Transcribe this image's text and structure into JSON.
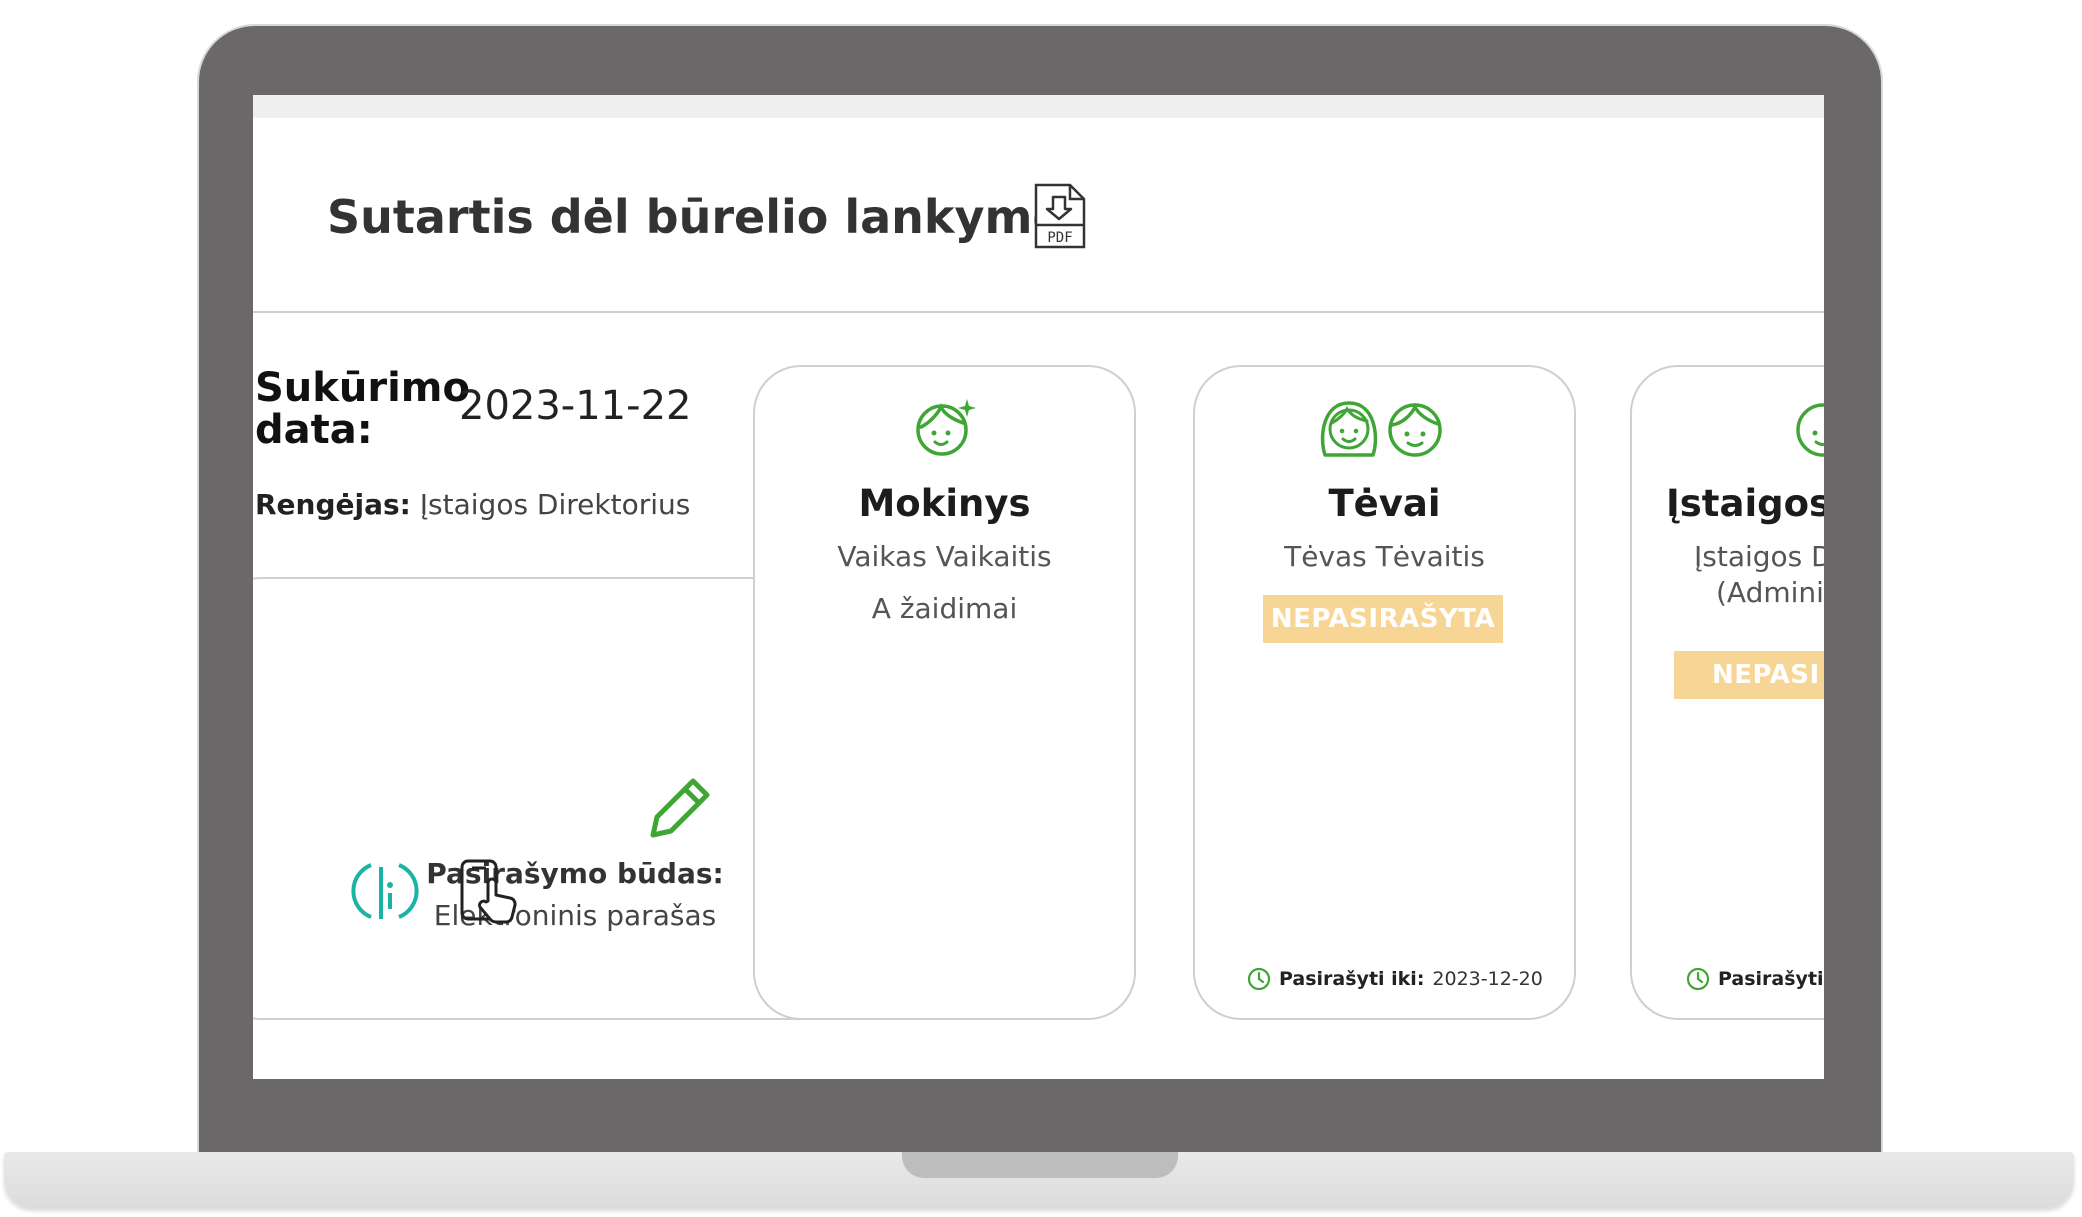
{
  "page": {
    "title": "Sutartis dėl būrelio lankymo",
    "pdf_label": "PDF"
  },
  "info": {
    "created_label": "Sukūrimo data:",
    "created_value": "2023-11-22",
    "author_label": "Rengėjas:",
    "author_value": "Įstaigos Direktorius"
  },
  "signing": {
    "label": "Pasirašymo būdas:",
    "value": "Elektroninis parašas"
  },
  "parties": {
    "student": {
      "title": "Mokinys",
      "line1": "Vaikas Vaikaitis",
      "line2": "A žaidimai"
    },
    "parents": {
      "title": "Tėvai",
      "line1": "Tėvas Tėvaitis",
      "status": "NEPASIRAŠYTA",
      "deadline_label": "Pasirašyti iki:",
      "deadline_value": "2023-12-20"
    },
    "institution": {
      "title": "Įstaigos",
      "line1": "Įstaigos D",
      "line2": "(Admini",
      "status": "NEPASI",
      "deadline_label": "Pasirašyti i"
    }
  },
  "colors": {
    "accent_green": "#3fa535",
    "badge": "#f7d594",
    "teal": "#1ab3a6"
  }
}
